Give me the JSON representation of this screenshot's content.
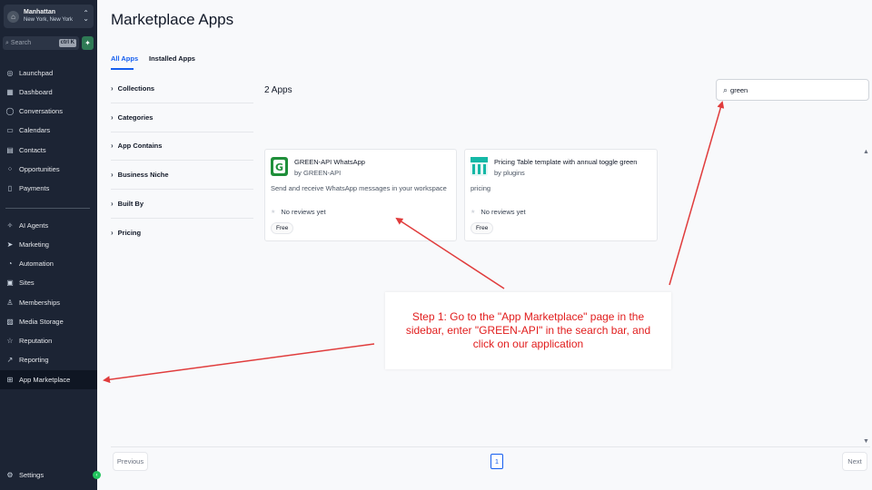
{
  "sidebar": {
    "account": {
      "location": "Manhattan",
      "sublocation": "New York, New York"
    },
    "search": {
      "placeholder": "Search",
      "shortcut": "ctrl K"
    },
    "items_top": [
      {
        "label": "Launchpad",
        "icon": "rocket-icon"
      },
      {
        "label": "Dashboard",
        "icon": "dashboard-icon"
      },
      {
        "label": "Conversations",
        "icon": "chat-icon"
      },
      {
        "label": "Calendars",
        "icon": "calendar-icon"
      },
      {
        "label": "Contacts",
        "icon": "contacts-icon"
      },
      {
        "label": "Opportunities",
        "icon": "opportunities-icon"
      },
      {
        "label": "Payments",
        "icon": "payments-icon"
      }
    ],
    "items_bottom": [
      {
        "label": "AI Agents",
        "icon": "sparkle-icon"
      },
      {
        "label": "Marketing",
        "icon": "send-icon"
      },
      {
        "label": "Automation",
        "icon": "automation-icon"
      },
      {
        "label": "Sites",
        "icon": "globe-icon"
      },
      {
        "label": "Memberships",
        "icon": "membership-icon"
      },
      {
        "label": "Media Storage",
        "icon": "image-icon"
      },
      {
        "label": "Reputation",
        "icon": "star-icon"
      },
      {
        "label": "Reporting",
        "icon": "chart-icon"
      },
      {
        "label": "App Marketplace",
        "icon": "apps-grid-icon"
      }
    ],
    "settings_label": "Settings"
  },
  "main": {
    "title": "Marketplace Apps",
    "tabs": [
      {
        "label": "All Apps"
      },
      {
        "label": "Installed Apps"
      }
    ],
    "filters": [
      {
        "label": "Collections"
      },
      {
        "label": "Categories"
      },
      {
        "label": "App Contains"
      },
      {
        "label": "Business Niche"
      },
      {
        "label": "Built By"
      },
      {
        "label": "Pricing"
      }
    ],
    "count_label": "2 Apps",
    "search_value": "green",
    "apps": [
      {
        "name": "GREEN-API WhatsApp",
        "by": "by GREEN-API",
        "description": "Send and receive WhatsApp messages in your workspace",
        "reviews": "No reviews yet",
        "price": "Free",
        "logo_color": "#1f8f3a"
      },
      {
        "name": "Pricing Table template with annual toggle green",
        "by": "by plugins",
        "description": "pricing",
        "reviews": "No reviews yet",
        "price": "Free",
        "logo_color": "#14b8a6"
      }
    ],
    "pagination": {
      "prev": "Previous",
      "page": "1",
      "next": "Next"
    }
  },
  "annotation": {
    "text": "Step 1: Go to the \"App Marketplace\" page in the sidebar, enter \"GREEN-API\" in the search bar, and click on our application",
    "color": "#e11d1d"
  },
  "colors": {
    "sidebar_bg": "#1c2434",
    "accent": "#155eef",
    "quick_add": "#2f7a55"
  }
}
